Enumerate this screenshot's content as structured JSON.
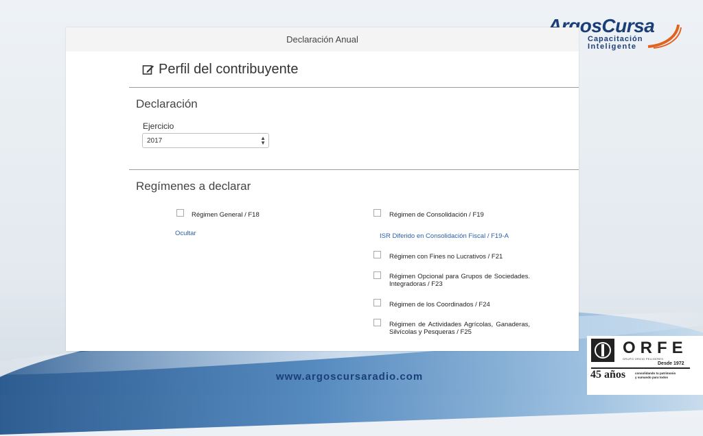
{
  "brand": {
    "logo_main": "ArgosCursa",
    "logo_sub1": "Capacitación",
    "logo_sub2": "Inteligente",
    "footer_url": "www.argoscursaradio.com"
  },
  "window": {
    "title": "Declaración Anual"
  },
  "page": {
    "title": "Perfil del contribuyente",
    "title_icon": "edit-icon"
  },
  "declaracion": {
    "section_title": "Declaración",
    "ejercicio_label": "Ejercicio",
    "ejercicio_value": "2017"
  },
  "regimenes": {
    "section_title": "Regímenes a declarar",
    "left": {
      "regimen_general": "Régimen General / F18",
      "ocultar": "Ocultar"
    },
    "right": {
      "consolidacion": "Régimen de Consolidación / F19",
      "isr_diferido": "ISR Diferido en Consolidación Fiscal / F19-A",
      "fines_no_lucrativos": "Régimen con Fines no Lucrativos / F21",
      "opcional_grupos": "Régimen Opcional para Grupos de Sociedades. Integradoras / F23",
      "coordinados": "Régimen de los Coordinados / F24",
      "actividades_agricolas": "Régimen de Actividades Agrícolas, Ganaderas, Silvícolas y Pesqueras / F25"
    }
  },
  "orfe": {
    "name": "ORFE",
    "small": "GRUPO ORGIO PELIGERES",
    "since": "Desde 1972",
    "years": "45 años",
    "tag1": "consolidando tu patrimonio",
    "tag2": "y sumando para todos"
  },
  "colors": {
    "brand_navy": "#1a3e78",
    "brand_orange": "#e0641f",
    "link_blue": "#2a5fa8"
  }
}
